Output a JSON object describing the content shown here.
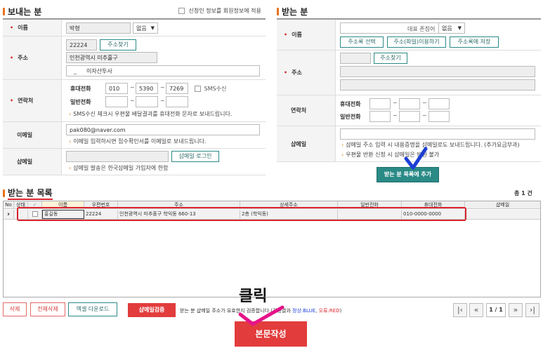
{
  "sender": {
    "title": "보내는 분",
    "apply_member_label": "신청인 정보를 회원정보에 적용",
    "name_label": "이름",
    "name_value": "박형",
    "title_select": "없음",
    "address_label": "주소",
    "zipcode": "22224",
    "find_address_btn": "주소찾기",
    "address1": "인천광역시 미추홀구",
    "address2": "이자산투사",
    "contact_label": "연락처",
    "mobile_label": "휴대전화",
    "mobile1": "010",
    "mobile2": "5390",
    "mobile3": "7269",
    "sms_label": "SMS수신",
    "phone_label": "일반전화",
    "sms_note": "SMS수신 체크시 우편물 배달결과를 휴대전화 문자로 보내드립니다.",
    "email_label": "이메일",
    "email_value": "pak080@naver.com",
    "email_note": "이메일 입력하시면 접수확인서를 이메일로 보내드립니다.",
    "shemail_label": "샵메일",
    "shemail_login_btn": "샵메일 로그인",
    "shemail_note": "샵메일 발송은 한국샵메일 가입자에 한함"
  },
  "receiver": {
    "title": "받는 분",
    "name_label": "이름",
    "honorific_label": "대표 존칭어",
    "honorific_select": "없음",
    "addrbook_select_btn": "주소록 선택",
    "addrbook_file_btn": "주소(파일)이용하기",
    "addrbook_save_btn": "주소록에 저장",
    "address_label": "주소",
    "find_address_btn": "주소찾기",
    "contact_label": "연락처",
    "mobile_label": "휴대전화",
    "phone_label": "일반전화",
    "shemail_label": "샵메일",
    "shemail_note1": "샵메일 주소 입력 시 내용증명을 샵메일로도 보내드립니다. (추가요금부과)",
    "shemail_note2": "우편물 반환 신청 시 샵메일은 반환 불가",
    "add_to_list_btn": "받는 분 목록에 추가"
  },
  "list": {
    "title": "받는 분 목록",
    "total": "총 1 건",
    "columns": [
      "No",
      "상태",
      "✓",
      "이름",
      "우편번호",
      "주소",
      "상세주소",
      "일반전화",
      "휴대전화",
      "샵메일"
    ],
    "rows": [
      {
        "no": "›",
        "status": "",
        "name": "홍길동",
        "zip": "22224",
        "address": "인천광역시 미추홀구 학익동 660-13",
        "detail": "2층 (학익동)",
        "phone": "",
        "mobile": "010-0000-0000",
        "shemail": ""
      }
    ]
  },
  "bottom": {
    "delete_btn": "삭제",
    "delete_all_btn": "전체삭제",
    "excel_btn": "엑셀 다운로드",
    "verify_btn": "샵메일검증",
    "verify_note_prefix": "받는 분 샵메일 주소가 유효한지 검증합니다.",
    "verify_note_mid": "(검증결과 ",
    "verify_normal": "정상:BLUE",
    "verify_sep": ", ",
    "verify_error": "오류:RED",
    "verify_close": ")",
    "page_info": "1 / 1",
    "compose_btn": "본문작성",
    "click_annotation": "클릭"
  },
  "colors": {
    "accent_orange": "#e8731a",
    "teal": "#2a8a86",
    "red_btn": "#e23c3c",
    "highlight_red": "#d9232d",
    "check_blue": "#1d3fd6"
  }
}
